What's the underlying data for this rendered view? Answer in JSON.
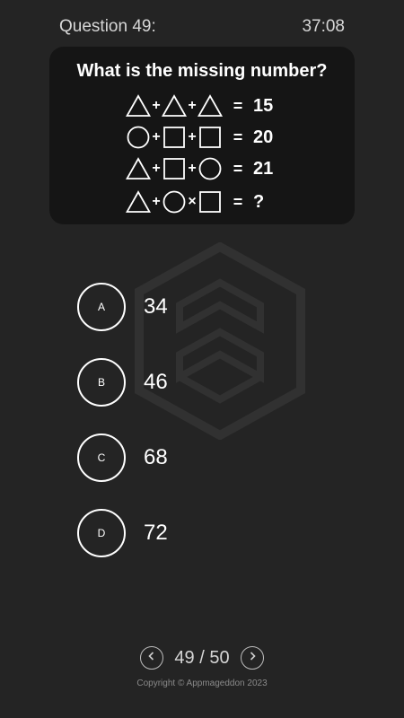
{
  "header": {
    "question_label": "Question 49:",
    "timer": "37:08"
  },
  "question": {
    "title": "What is the missing number?",
    "equations": [
      {
        "terms": [
          "triangle",
          "triangle",
          "triangle"
        ],
        "ops": [
          "+",
          "+"
        ],
        "equals": "=",
        "result": "15"
      },
      {
        "terms": [
          "circle",
          "square",
          "square"
        ],
        "ops": [
          "+",
          "+"
        ],
        "equals": "=",
        "result": "20"
      },
      {
        "terms": [
          "triangle",
          "square",
          "circle"
        ],
        "ops": [
          "+",
          "+"
        ],
        "equals": "=",
        "result": "21"
      },
      {
        "terms": [
          "triangle",
          "circle",
          "square"
        ],
        "ops": [
          "+",
          "×"
        ],
        "equals": "=",
        "result": "?"
      }
    ]
  },
  "options": [
    {
      "letter": "A",
      "value": "34"
    },
    {
      "letter": "B",
      "value": "46"
    },
    {
      "letter": "C",
      "value": "68"
    },
    {
      "letter": "D",
      "value": "72"
    }
  ],
  "pager": {
    "text": "49 / 50",
    "prev_icon": "chevron-left-icon",
    "next_icon": "chevron-right-icon"
  },
  "footer": {
    "copyright": "Copyright © Appmageddon 2023"
  },
  "colors": {
    "background": "#242424",
    "card": "#151515",
    "foreground": "#ffffff"
  }
}
